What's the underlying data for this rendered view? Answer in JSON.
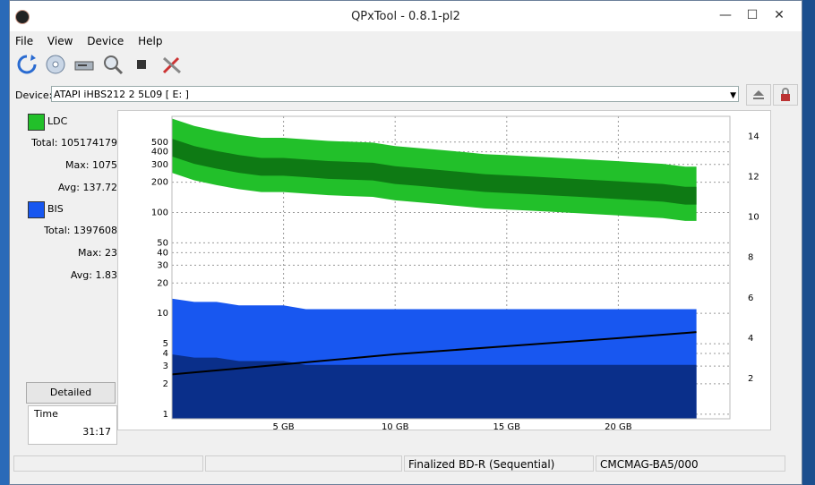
{
  "window": {
    "title": "QPxTool - 0.8.1-pl2"
  },
  "menu": {
    "items": [
      "File",
      "View",
      "Device",
      "Help"
    ]
  },
  "device": {
    "label": "Device:",
    "value": "ATAPI   iHBS212   2     5L09 [ E: ]"
  },
  "stats": {
    "ldc": {
      "label": "LDC",
      "color": "#22c02a",
      "total_label": "Total:",
      "total": "105174179",
      "max_label": "Max:",
      "max": "1075",
      "avg_label": "Avg:",
      "avg": "137.72"
    },
    "bis": {
      "label": "BIS",
      "color": "#1857f0",
      "total_label": "Total:",
      "total": "1397608",
      "max_label": "Max:",
      "max": "23",
      "avg_label": "Avg:",
      "avg": "1.83"
    }
  },
  "detailed_button": "Detailed",
  "time": {
    "label": "Time",
    "value": "31:17"
  },
  "status": {
    "disc": "Finalized BD-R (Sequential)",
    "media": "CMCMAG-BA5/000"
  },
  "chart_data": {
    "type": "area",
    "x_ticks": [
      "5 GB",
      "10 GB",
      "15 GB",
      "20 GB"
    ],
    "x_tick_values": [
      5,
      10,
      15,
      20
    ],
    "xlim": [
      0,
      25
    ],
    "y_left_ticks": [
      "500",
      "400",
      "300",
      "200",
      "100",
      "50",
      "40",
      "30",
      "20",
      "10",
      "5",
      "4",
      "3",
      "2",
      "1"
    ],
    "y_right_ticks": [
      "14",
      "12",
      "10",
      "8",
      "6",
      "4",
      "2"
    ],
    "y_left_scale": "log",
    "grid": true,
    "series": [
      {
        "name": "LDC",
        "x": [
          0,
          1,
          2,
          3,
          4,
          5,
          6,
          7,
          8,
          9,
          10,
          11,
          12,
          13,
          14,
          15,
          16,
          17,
          18,
          19,
          20,
          21,
          22,
          23,
          23.5
        ],
        "values": [
          450,
          380,
          340,
          310,
          290,
          290,
          280,
          270,
          265,
          260,
          240,
          230,
          220,
          210,
          200,
          195,
          190,
          185,
          180,
          175,
          170,
          165,
          160,
          150,
          150
        ]
      },
      {
        "name": "BIS",
        "x": [
          0,
          1,
          2,
          3,
          4,
          5,
          6,
          7,
          8,
          9,
          10,
          11,
          12,
          13,
          14,
          15,
          16,
          17,
          18,
          19,
          20,
          21,
          22,
          23,
          23.5
        ],
        "values": [
          14,
          13,
          13,
          12,
          12,
          12,
          11,
          11,
          11,
          11,
          11,
          11,
          11,
          11,
          11,
          11,
          11,
          11,
          11,
          11,
          11,
          11,
          11,
          11,
          11
        ]
      },
      {
        "name": "Speed",
        "x": [
          0,
          5,
          10,
          15,
          20,
          23.5
        ],
        "values": [
          2.2,
          2.7,
          3.2,
          3.6,
          4.0,
          4.3
        ]
      }
    ]
  }
}
